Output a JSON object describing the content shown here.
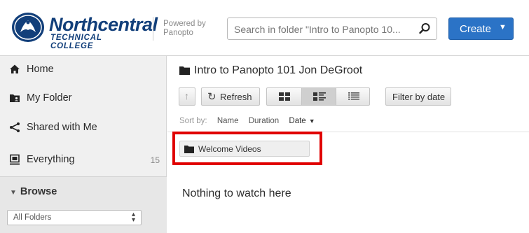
{
  "header": {
    "logo_line1": "Northcentral",
    "logo_line2": "TECHNICAL COLLEGE",
    "powered_by_line1": "Powered by",
    "powered_by_line2": "Panopto",
    "search_placeholder": "Search in folder \"Intro to Panopto 10...",
    "create_label": "Create",
    "brand_color": "#123f7a",
    "accent_color": "#2b73c6"
  },
  "sidebar": {
    "items": [
      {
        "label": "Home",
        "icon": "home-icon"
      },
      {
        "label": "My Folder",
        "icon": "my-folder-icon"
      },
      {
        "label": "Shared with Me",
        "icon": "share-icon"
      },
      {
        "label": "Everything",
        "icon": "everything-icon",
        "count": "15"
      }
    ],
    "browse_label": "Browse",
    "folders_select_value": "All Folders"
  },
  "main": {
    "folder_title": "Intro to Panopto 101 Jon DeGroot",
    "toolbar": {
      "refresh_label": "Refresh",
      "filter_label": "Filter by date",
      "selected_view": "detail"
    },
    "sort": {
      "label": "Sort by:",
      "options": [
        "Name",
        "Duration",
        "Date"
      ],
      "active": "Date"
    },
    "subfolders": [
      {
        "label": "Welcome Videos"
      }
    ],
    "empty_message": "Nothing to watch here",
    "highlight_color": "#e00000"
  }
}
